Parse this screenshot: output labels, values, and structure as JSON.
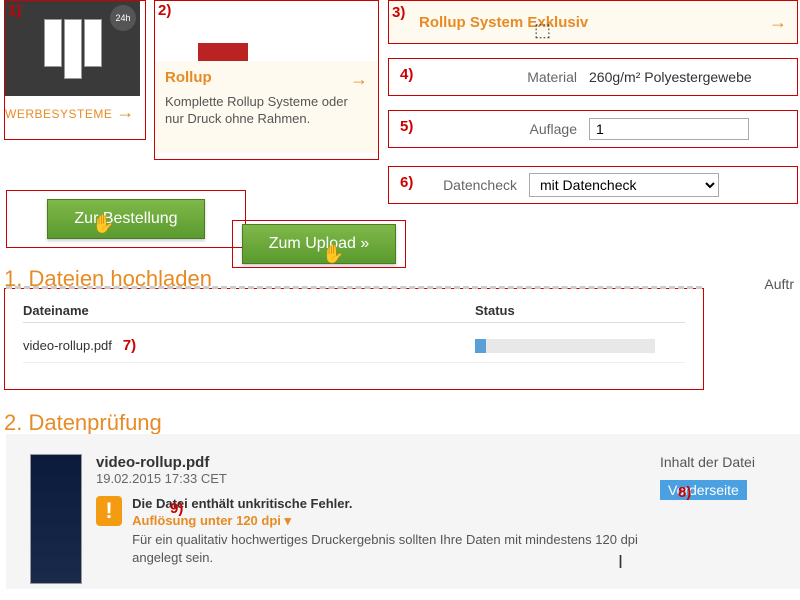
{
  "steps": [
    "1)",
    "2)",
    "3)",
    "4)",
    "5)",
    "6)",
    "7)",
    "8)",
    "9)"
  ],
  "card1": {
    "link": "WERBESYSTEME",
    "badge": "24h"
  },
  "card2": {
    "title": "Rollup",
    "desc": "Komplette Rollup Systeme oder nur Druck ohne Rahmen."
  },
  "card3": {
    "title": "Rollup System Exklusiv"
  },
  "opt": {
    "material_label": "Material",
    "material_value": "260g/m² Polyestergewebe",
    "auflage_label": "Auflage",
    "auflage_value": "1",
    "check_label": "Datencheck",
    "check_value": "mit Datencheck"
  },
  "buttons": {
    "order": "Zur Bestellung",
    "upload": "Zum Upload »"
  },
  "section1": "1. Dateien hochladen",
  "section2": "2. Datenprüfung",
  "auftr": "Auftr",
  "table": {
    "h_name": "Dateiname",
    "h_status": "Status",
    "file": "video-rollup.pdf"
  },
  "check": {
    "fname": "video-rollup.pdf",
    "fdate": "19.02.2015 17:33 CET",
    "warn_title": "Die Datei enthält unkritische Fehler.",
    "warn_sub": "Auflösung unter 120 dpi",
    "warn_desc": "Für ein qualitativ hochwertiges Druckergebnis sollten Ihre Daten mit mindestens 120 dpi angelegt sein.",
    "inhalt": "Inhalt der Datei",
    "seite": "Vorderseite"
  }
}
